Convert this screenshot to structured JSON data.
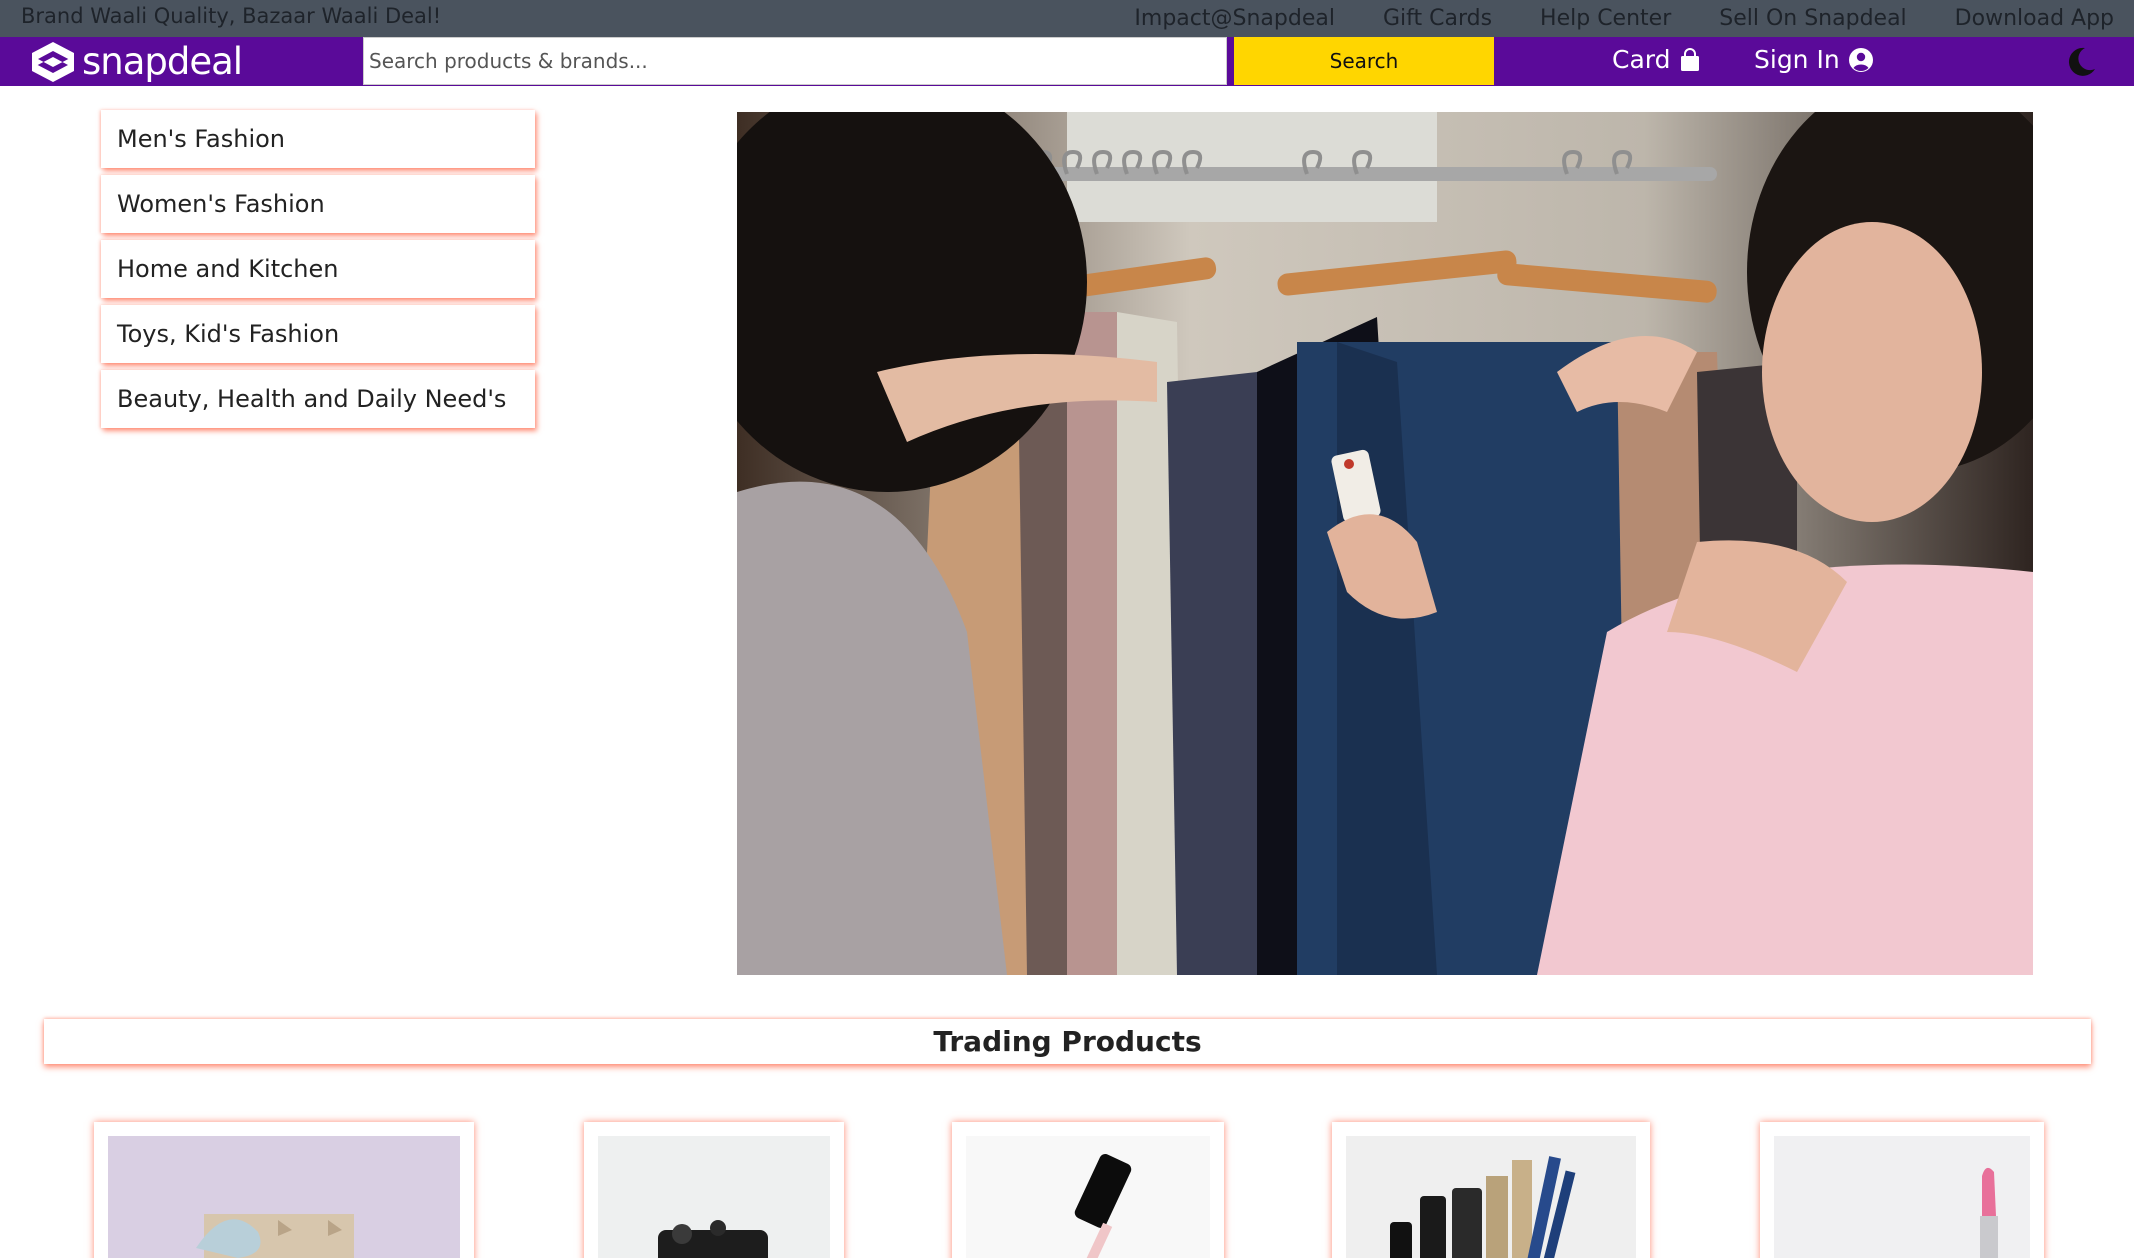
{
  "topbar": {
    "tagline": "Brand Waali Quality, Bazaar Waali Deal!",
    "links": [
      "Impact@Snapdeal",
      "Gift Cards",
      "Help Center",
      "Sell On Snapdeal",
      "Download App"
    ]
  },
  "header": {
    "logo_text": "snapdeal",
    "search": {
      "placeholder": "Search products & brands...",
      "button_label": "Search"
    },
    "card_label": "Card",
    "signin_label": "Sign In"
  },
  "colors": {
    "nav_purple": "#5a0a99",
    "top_strip": "#4a535e",
    "search_yellow": "#ffd600",
    "shadow_accent": "#ff6e50"
  },
  "categories": [
    "Men's Fashion",
    "Women's Fashion",
    "Home and Kitchen",
    "Toys, Kid's Fashion",
    "Beauty, Health and Daily Need's"
  ],
  "trading": {
    "title": "Trading Products"
  }
}
